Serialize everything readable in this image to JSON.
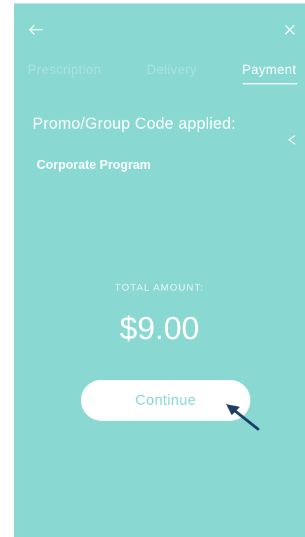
{
  "nav": {
    "back_icon": "arrow-left-icon",
    "close_icon": "close-icon"
  },
  "tabs": [
    {
      "label": "Prescription",
      "active": false
    },
    {
      "label": "Delivery",
      "active": false
    },
    {
      "label": "Payment",
      "active": true
    }
  ],
  "promo": {
    "heading": "Promo/Group Code applied:",
    "value": "Corporate Program",
    "toggle_icon": "chevron-icon"
  },
  "total": {
    "label": "TOTAL AMOUNT:",
    "amount": "$9.00"
  },
  "actions": {
    "continue_label": "Continue"
  },
  "colors": {
    "background": "#89d8d1",
    "text": "#ffffff",
    "button_bg": "#ffffff",
    "button_text": "#89d8d1",
    "annotation_arrow": "#1a3e66"
  }
}
